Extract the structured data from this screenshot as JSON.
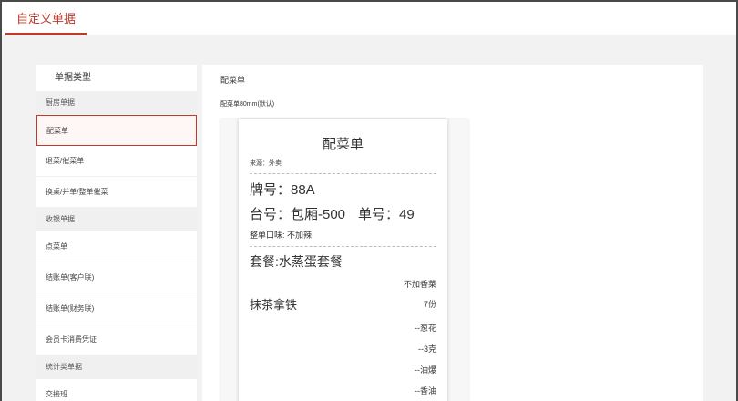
{
  "tab": {
    "label": "自定义单据"
  },
  "sidebar": {
    "title": "单据类型",
    "sections": [
      {
        "header": "厨房单据",
        "items": [
          "配菜单",
          "退菜/催菜单",
          "换桌/并单/整单催菜"
        ]
      },
      {
        "header": "收银单据",
        "items": [
          "点菜单",
          "结账单(客户联)",
          "结账单(财务联)",
          "会员卡消费凭证"
        ]
      },
      {
        "header": "统计类单据",
        "items": [
          "交接班"
        ]
      }
    ],
    "active_item": "配菜单"
  },
  "content": {
    "title": "配菜单",
    "template_label": "配菜单80mm(默认)"
  },
  "receipt": {
    "title": "配菜单",
    "source": "来源：外卖",
    "plate": "牌号：88A",
    "table": "台号：包厢-500",
    "order_no": "单号：49",
    "whole_note": "整单口味: 不加辣",
    "combo": "套餐:水蒸蛋套餐",
    "combo_note": "不加香菜",
    "dish": "抹茶拿铁",
    "dish_qty": "7份",
    "opt1": "--葱花",
    "opt2": "--3克",
    "opt3": "--油爆",
    "opt4": "--香油"
  },
  "colors": {
    "accent": "#c0392b",
    "background": "#f2f2f2"
  }
}
